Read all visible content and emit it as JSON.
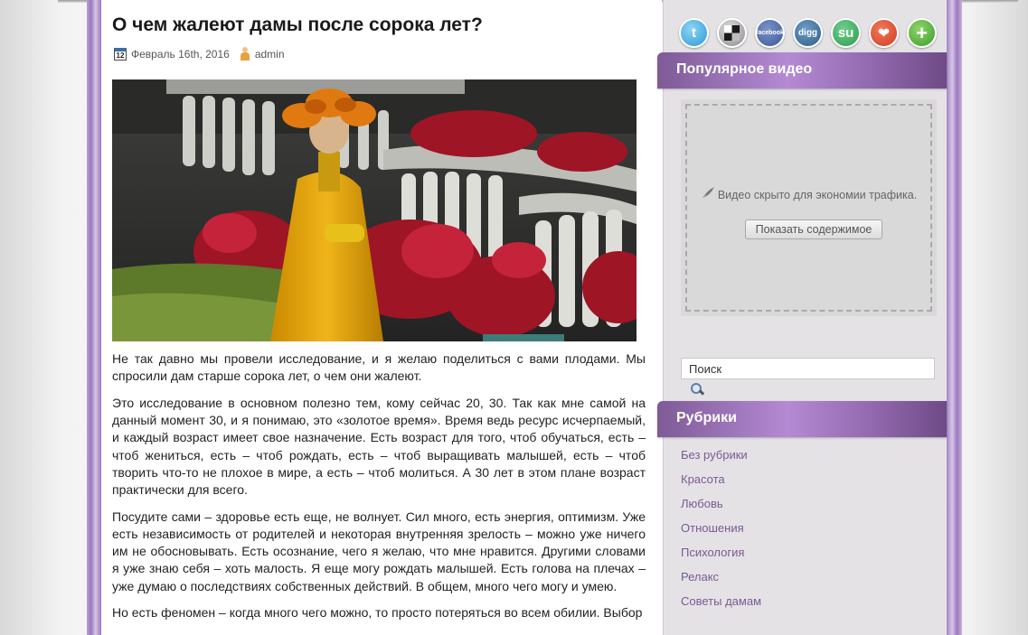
{
  "post": {
    "title": "О чем жалеют дамы после сорока лет?",
    "date": "Февраль 16th, 2016",
    "author": "admin",
    "paragraphs": [
      "Не так давно мы провели исследование, и я желаю поделиться с вами плодами. Мы спросили дам старше сорока лет, о чем они жалеют.",
      "Это исследование в основном полезно тем, кому сейчас 20, 30. Так как мне самой на данный момент 30, и я понимаю, это «золотое время». Время ведь ресурс исчерпаемый, и каждый возраст имеет свое назначение. Есть возраст для того, чтоб обучаться, есть – чтоб жениться, есть – чтоб рождать, есть – чтоб выращивать малышей, есть – чтоб творить что-то не плохое в мире, а есть – чтоб молиться. А 30 лет в этом плане возраст практически для всего.",
      "Посудите сами – здоровье есть еще, не волнует. Сил много, есть энергия, оптимизм. Уже есть независимость от родителей и некоторая внутренняя зрелость – можно уже ничего им не обосновывать. Есть осознание, чего я желаю, что мне нравится. Другими словами я уже знаю себя – хоть малость. Я еще могу рождать малышей. Есть голова на плечах – уже думаю о последствиях собственных действий. В общем, много чего могу и умею.",
      "Но есть феномен – когда много чего можно, то просто потеряться во всем обилии. Выбор"
    ]
  },
  "social": [
    {
      "name": "twitter",
      "glyph": "t"
    },
    {
      "name": "delicious",
      "glyph": ""
    },
    {
      "name": "facebook",
      "glyph": "facebook"
    },
    {
      "name": "digg",
      "glyph": "digg"
    },
    {
      "name": "stumbleupon",
      "glyph": "su"
    },
    {
      "name": "favorite",
      "glyph": "❤"
    },
    {
      "name": "more",
      "glyph": "+"
    }
  ],
  "sidebar": {
    "video_widget_title": "Популярное видео",
    "video_hidden_text": "Видео скрыто для экономии трафика.",
    "show_button": "Показать содержимое",
    "search_value": "Поиск",
    "categories_title": "Рубрики",
    "categories": [
      "Без рубрики",
      "Красота",
      "Любовь",
      "Отношения",
      "Психология",
      "Релакс",
      "Советы дамам"
    ]
  },
  "colors": {
    "frame": "#9b78bf",
    "widget_header": "#b48ad4",
    "link": "#7a5a92"
  }
}
